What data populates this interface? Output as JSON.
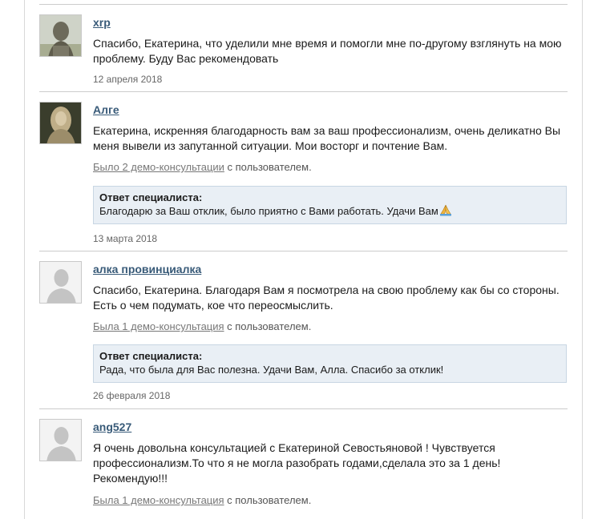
{
  "reviews": [
    {
      "author": "xrp",
      "avatar_icon": "portrait-statue-icon",
      "text": "Спасибо, Екатерина, что уделили мне время и помогли мне по-другому взглянуть на мою проблему. Буду Вас рекомендовать",
      "date": "12 апреля 2018"
    },
    {
      "author": "Алге",
      "avatar_icon": "portrait-woman-icon",
      "text": "Екатерина, искренняя благодарность вам за ваш профессионализм, очень деликатно Вы меня вывели из запутанной ситуации. Мои восторг и почтение Вам.",
      "consult_link": "Было 2 демо-консультации",
      "consult_suffix": " с пользователем.",
      "answer_title": "Ответ специалиста:",
      "answer_text": "Благодарю за Ваш отклик, было приятно с Вами работать. Удачи Вам",
      "answer_icon": "praying-hands-icon",
      "date": "13 марта 2018"
    },
    {
      "author": "алка провинциалка",
      "avatar_icon": "default-user-avatar-icon",
      "text": "Спасибо, Екатерина. Благодаря Вам я посмотрела на свою проблему как бы со стороны. Есть о чем подумать, кое что переосмыслить.",
      "consult_link": "Была 1 демо-консультация",
      "consult_suffix": " с пользователем.",
      "answer_title": "Ответ специалиста:",
      "answer_text": "Рада, что была для Вас полезна. Удачи Вам, Алла. Спасибо за отклик!",
      "date": "26 февраля 2018"
    },
    {
      "author": "ang527",
      "avatar_icon": "default-user-avatar-icon",
      "text": "Я очень довольна консультацией с Екатериной Севостьяновой ! Чувствуется профессионализм.То что я не могла разобрать годами,сделала это за 1 день!Рекомендую!!!",
      "consult_link": "Была 1 демо-консультация",
      "consult_suffix": " с пользователем."
    }
  ],
  "colors": {
    "author_link": "#385a78",
    "answer_bg": "#e9eff5",
    "answer_border": "#c8d6e3"
  }
}
